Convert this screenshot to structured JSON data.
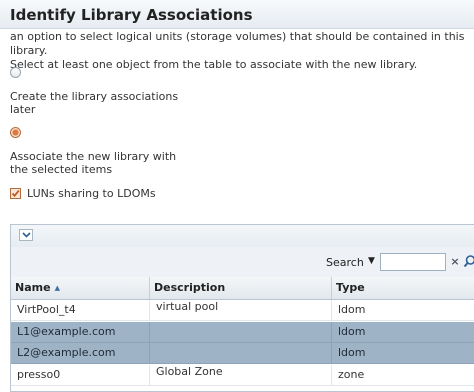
{
  "header": {
    "title": "Identify Library Associations"
  },
  "description": {
    "line1": "an option to select logical units (storage volumes) that should be contained in this library.",
    "line2": "Select at least one object from the table to associate with the new library."
  },
  "options": [
    {
      "line1": "Create the library associations",
      "line2": "later",
      "selected": false
    },
    {
      "line1": "Associate the new library with",
      "line2": "the selected items",
      "selected": true
    }
  ],
  "checkbox": {
    "label": "LUNs sharing to LDOMs",
    "checked": true
  },
  "table": {
    "search_label": "Search",
    "search_value": "",
    "clear_symbol": "×",
    "columns": {
      "name": "Name",
      "description": "Description",
      "type": "Type"
    },
    "sort_indicator": "▲",
    "rows": [
      {
        "name": "VirtPool_t4",
        "description": "virtual pool",
        "type": "ldom",
        "selected": false
      },
      {
        "name": "L1@example.com",
        "description": "",
        "type": "ldom",
        "selected": true
      },
      {
        "name": "L2@example.com",
        "description": "",
        "type": "ldom",
        "selected": true
      },
      {
        "name": "presso0",
        "description": "Global Zone",
        "type": "zone",
        "selected": false
      }
    ]
  },
  "icons": {
    "expand": "chevron-down-icon",
    "search": "magnifier-icon",
    "clear": "close-icon"
  },
  "colors": {
    "accent_orange": "#e2773a",
    "selected_row": "#9fb3c6",
    "header_text": "#222222"
  }
}
